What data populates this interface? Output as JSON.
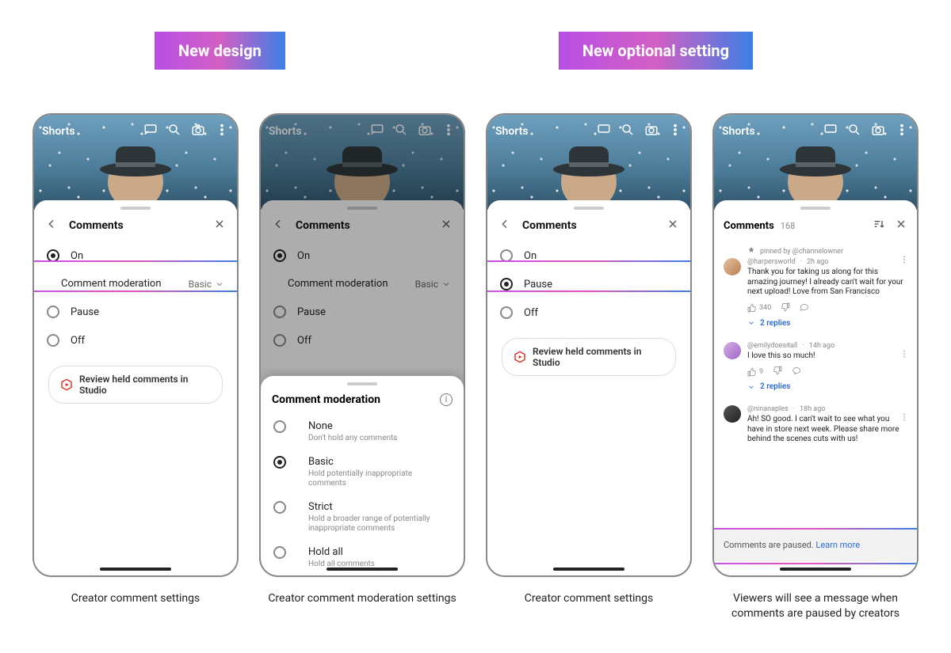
{
  "badges": {
    "left": "New design",
    "right": "New optional setting"
  },
  "topbar": {
    "label": "Shorts"
  },
  "sheet": {
    "title": "Comments"
  },
  "p1": {
    "caption": "Creator comment settings",
    "options": {
      "on": "On",
      "moderation_label": "Comment moderation",
      "moderation_value": "Basic",
      "pause": "Pause",
      "off": "Off"
    },
    "chip": "Review held comments in Studio"
  },
  "p2": {
    "caption": "Creator comment moderation settings",
    "options": {
      "on": "On",
      "moderation_label": "Comment moderation",
      "moderation_value": "Basic",
      "pause": "Pause",
      "off": "Off"
    },
    "sheet_title": "Comment moderation",
    "sub": [
      {
        "t": "None",
        "d": "Don't hold any comments"
      },
      {
        "t": "Basic",
        "d": "Hold potentially inappropriate comments"
      },
      {
        "t": "Strict",
        "d": "Hold a broader range of potentially inappropriate comments"
      },
      {
        "t": "Hold all",
        "d": "Hold all comments"
      }
    ]
  },
  "p3": {
    "caption": "Creator comment settings",
    "options": {
      "on": "On",
      "pause": "Pause",
      "off": "Off"
    },
    "chip": "Review held comments in Studio"
  },
  "p4": {
    "caption": "Viewers will see a message when comments are paused by creators",
    "title": "Comments",
    "count": "168",
    "pinned_label": "pinned by @channelowner",
    "comments": [
      {
        "user": "@harpersworld",
        "time": "2h ago",
        "msg": "Thank you for taking us along for this amazing journey! I already can't wait for your next upload! Love from San Francisco",
        "likes": "340",
        "replies": "2 replies"
      },
      {
        "user": "@emilydoesitall",
        "time": "14h ago",
        "msg": "I love this so much!",
        "likes": "9",
        "replies": "2 replies"
      },
      {
        "user": "@ninanaples",
        "time": "18h ago",
        "msg": "Ah! SO good. I can't wait to see what you have in store next week. Please share more behind the scenes cuts with us!",
        "likes": "",
        "replies": ""
      }
    ],
    "paused": "Comments are paused.",
    "learn": "Learn more"
  }
}
